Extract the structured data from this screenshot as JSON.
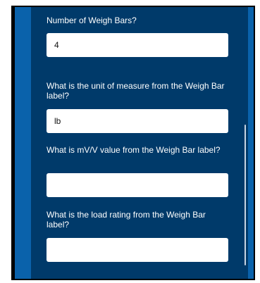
{
  "form": {
    "questions": [
      {
        "label": "Number of Weigh Bars?",
        "value": "4"
      },
      {
        "label": "What is the unit of measure from the Weigh Bar label?",
        "value": "lb"
      },
      {
        "label": "What is mV/V value from the Weigh Bar label?",
        "value": ""
      },
      {
        "label": "What is the load rating from the Weigh Bar label?",
        "value": ""
      }
    ]
  },
  "colors": {
    "panel": "#003a6a",
    "accent_strip": "#0a62ab",
    "frame": "#000000",
    "input_bg": "#ffffff"
  }
}
